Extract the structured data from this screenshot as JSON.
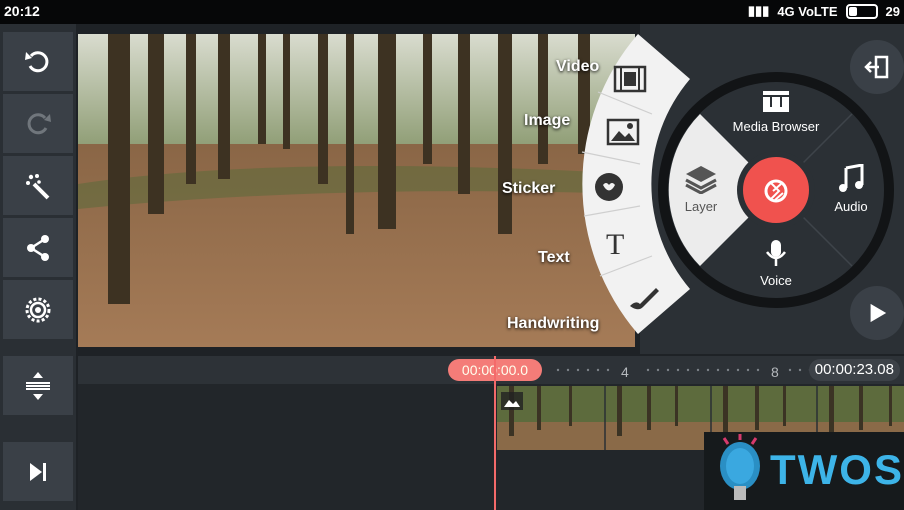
{
  "status_bar": {
    "time": "20:12",
    "network": "4G VoLTE",
    "battery": "29"
  },
  "left_toolbar": {
    "buttons": [
      {
        "name": "undo-icon"
      },
      {
        "name": "redo-icon"
      },
      {
        "name": "magic-wand-icon"
      },
      {
        "name": "share-icon"
      },
      {
        "name": "settings-icon"
      },
      {
        "name": "timeline-resize-icon"
      },
      {
        "name": "skip-to-end-icon"
      }
    ]
  },
  "media_menu": {
    "items": [
      {
        "label": "Video",
        "icon": "film-icon"
      },
      {
        "label": "Image",
        "icon": "image-icon"
      },
      {
        "label": "Sticker",
        "icon": "sticker-icon"
      },
      {
        "label": "Text",
        "icon": "text-icon"
      },
      {
        "label": "Handwriting",
        "icon": "brush-icon"
      }
    ]
  },
  "main_wheel": {
    "media_browser": "Media Browser",
    "layer": "Layer",
    "audio": "Audio",
    "voice": "Voice",
    "record_icon": "camera-shutter-icon"
  },
  "timeline": {
    "current_time": "00:00:00.0",
    "end_time": "00:00:23.08",
    "ticks": [
      "4",
      "8"
    ]
  },
  "watermark": {
    "text": "TWOS"
  },
  "colors": {
    "accent": "#f0524e",
    "playhead": "#f47c78"
  }
}
